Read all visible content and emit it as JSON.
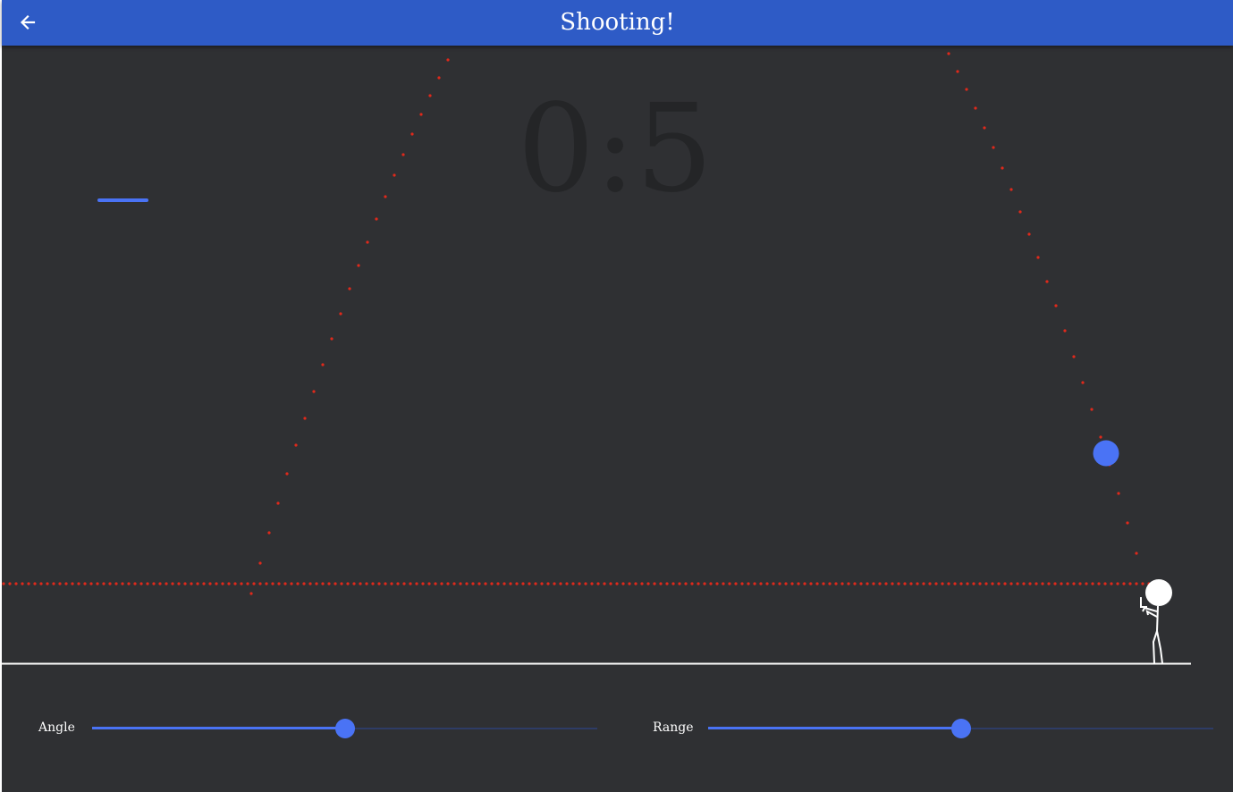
{
  "app": {
    "title": "Shooting!",
    "back_icon": "arrow-left-icon"
  },
  "game": {
    "score_text": "0:5",
    "colors": {
      "background": "#2f3033",
      "appbar": "#2e5bc6",
      "accent": "#4a73f5",
      "trajectory": "#e0291b",
      "score": "#242527",
      "ground": "#ffffff",
      "player": "#ffffff"
    }
  },
  "controls": {
    "angle": {
      "label": "Angle",
      "value": 0.5
    },
    "range": {
      "label": "Range",
      "value": 0.5
    }
  }
}
